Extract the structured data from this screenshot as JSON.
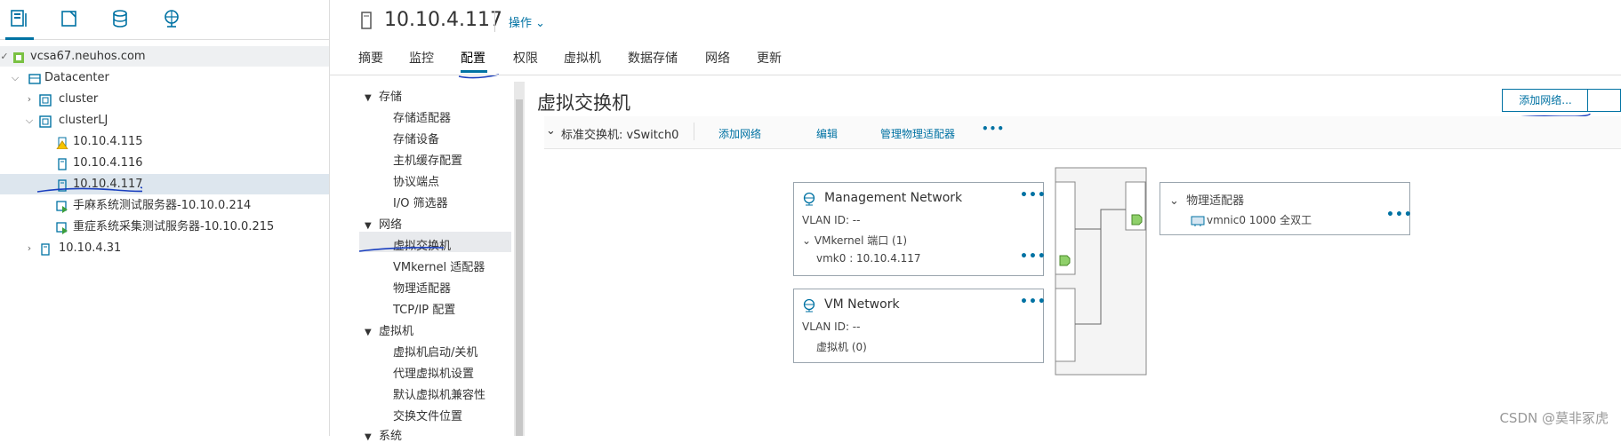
{
  "left_nav": {
    "tabs": [
      "hosts-clusters-icon",
      "vms-templates-icon",
      "storage-icon",
      "networking-icon"
    ],
    "tree": [
      {
        "label": "vcsa67.neuhos.com",
        "icon": "vcenter-icon",
        "type": "root"
      },
      {
        "label": "Datacenter",
        "icon": "datacenter-icon"
      },
      {
        "label": "cluster",
        "icon": "cluster-icon"
      },
      {
        "label": "clusterLJ",
        "icon": "cluster-icon"
      },
      {
        "label": "10.10.4.115",
        "icon": "host-warning-icon"
      },
      {
        "label": "10.10.4.116",
        "icon": "host-icon"
      },
      {
        "label": "10.10.4.117",
        "icon": "host-icon"
      },
      {
        "label": "手麻系统测试服务器-10.10.0.214",
        "icon": "vm-running-icon"
      },
      {
        "label": "重症系统采集测试服务器-10.10.0.215",
        "icon": "vm-running-icon"
      },
      {
        "label": "10.10.4.31",
        "icon": "host-icon"
      }
    ]
  },
  "header": {
    "host": "10.10.4.117",
    "actions": "操作",
    "tabs": [
      "摘要",
      "监控",
      "配置",
      "权限",
      "虚拟机",
      "数据存储",
      "网络",
      "更新"
    ],
    "active_tab": "配置"
  },
  "config_nav": {
    "groups": [
      {
        "label": "存储",
        "items": [
          "存储适配器",
          "存储设备",
          "主机缓存配置",
          "协议端点",
          "I/O 筛选器"
        ]
      },
      {
        "label": "网络",
        "items": [
          "虚拟交换机",
          "VMkernel 适配器",
          "物理适配器",
          "TCP/IP 配置"
        ]
      },
      {
        "label": "虚拟机",
        "items": [
          "虚拟机启动/关机",
          "代理虚拟机设置",
          "默认虚拟机兼容性",
          "交换文件位置"
        ]
      },
      {
        "label": "系统",
        "items": []
      }
    ],
    "selected": "虚拟交换机"
  },
  "content": {
    "title": "虚拟交换机",
    "add_network_button": "添加网络...",
    "switch_label": "标准交换机: vSwitch0",
    "links": [
      "添加网络",
      "编辑",
      "管理物理适配器"
    ],
    "more": "•••",
    "port_groups": [
      {
        "name": "Management Network",
        "vlan": "VLAN ID: --",
        "sub_header": "VMkernel 端口 (1)",
        "sub_item": "vmk0 : 10.10.4.117"
      },
      {
        "name": "VM Network",
        "vlan": "VLAN ID: --",
        "sub_header": "虚拟机 (0)"
      }
    ],
    "physical": {
      "header": "物理适配器",
      "nic": "vmnic0 1000 全双工"
    }
  },
  "watermark": "CSDN @莫非冢虎",
  "colors": {
    "accent": "#0072a3",
    "pen": "#1a3fbf",
    "port_green": "#8fd06a"
  }
}
